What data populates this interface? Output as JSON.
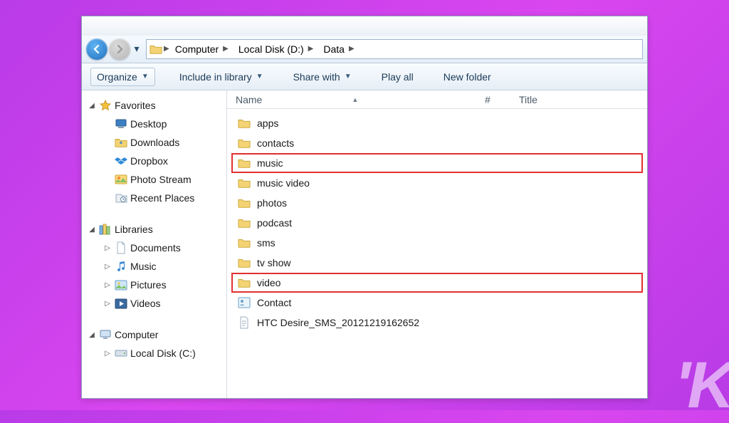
{
  "breadcrumb": {
    "segments": [
      "Computer",
      "Local Disk (D:)",
      "Data"
    ]
  },
  "toolbar": {
    "organize": "Organize",
    "include": "Include in library",
    "share": "Share with",
    "playall": "Play all",
    "newfolder": "New folder"
  },
  "columns": {
    "name": "Name",
    "num": "#",
    "title": "Title"
  },
  "sidebar": {
    "favorites": {
      "label": "Favorites",
      "items": [
        {
          "label": "Desktop",
          "icon": "desktop"
        },
        {
          "label": "Downloads",
          "icon": "downloads"
        },
        {
          "label": "Dropbox",
          "icon": "dropbox"
        },
        {
          "label": "Photo Stream",
          "icon": "photostream"
        },
        {
          "label": "Recent Places",
          "icon": "recent"
        }
      ]
    },
    "libraries": {
      "label": "Libraries",
      "items": [
        {
          "label": "Documents",
          "icon": "documents"
        },
        {
          "label": "Music",
          "icon": "music"
        },
        {
          "label": "Pictures",
          "icon": "pictures"
        },
        {
          "label": "Videos",
          "icon": "videos"
        }
      ]
    },
    "computer": {
      "label": "Computer",
      "items": [
        {
          "label": "Local Disk (C:)",
          "icon": "disk"
        }
      ]
    }
  },
  "files": [
    {
      "name": "apps",
      "type": "folder",
      "highlight": false
    },
    {
      "name": "contacts",
      "type": "folder",
      "highlight": false
    },
    {
      "name": "music",
      "type": "folder",
      "highlight": true
    },
    {
      "name": "music video",
      "type": "folder",
      "highlight": false
    },
    {
      "name": "photos",
      "type": "folder",
      "highlight": false
    },
    {
      "name": "podcast",
      "type": "folder",
      "highlight": false
    },
    {
      "name": "sms",
      "type": "folder",
      "highlight": false
    },
    {
      "name": "tv show",
      "type": "folder",
      "highlight": false
    },
    {
      "name": "video",
      "type": "folder",
      "highlight": true
    },
    {
      "name": "Contact",
      "type": "contact",
      "highlight": false
    },
    {
      "name": "HTC Desire_SMS_20121219162652",
      "type": "textfile",
      "highlight": false
    }
  ],
  "watermark": "'K"
}
